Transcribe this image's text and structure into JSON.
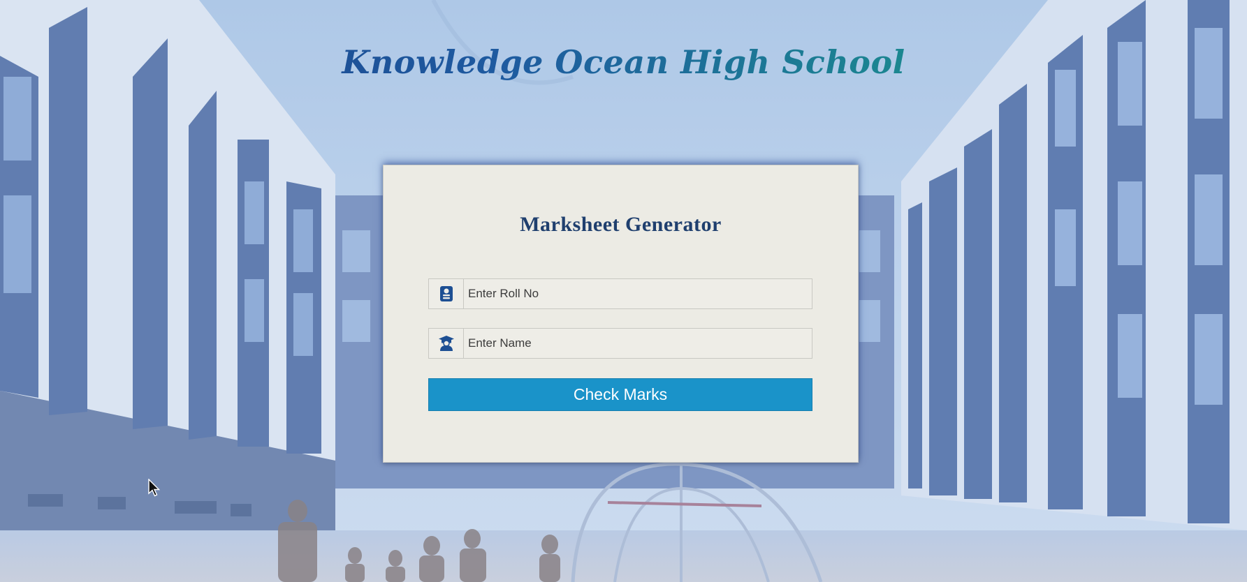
{
  "header": {
    "school_name": "Knowledge Ocean High School"
  },
  "form": {
    "title": "Marksheet Generator",
    "roll_input": {
      "placeholder": "Enter Roll No",
      "value": ""
    },
    "name_input": {
      "placeholder": "Enter Name",
      "value": ""
    },
    "submit_label": "Check Marks"
  },
  "icons": {
    "roll": "id-card-icon",
    "name": "graduate-icon",
    "cursor": "mouse-pointer-icon"
  },
  "colors": {
    "button": "#1a93c9",
    "title_text": "#1f3f6e",
    "school_title_start": "#1a3f86",
    "school_title_end": "#1aa58f",
    "card_bg": "#ecebe4"
  }
}
